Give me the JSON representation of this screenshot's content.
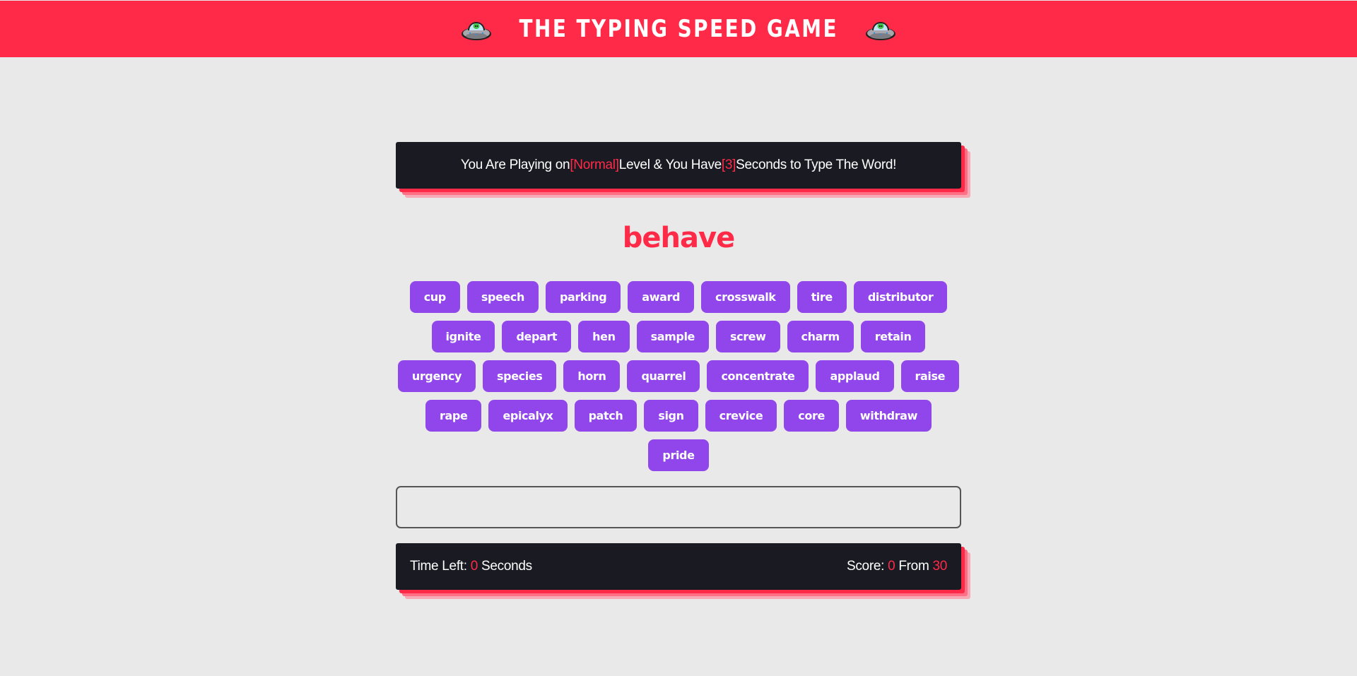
{
  "header": {
    "title": "The Typing Speed Game",
    "left_icon": "ufo-alien-icon",
    "right_icon": "ufo-alien-icon"
  },
  "message": {
    "prefix": "You Are Playing on ",
    "level": "[Normal]",
    "middle": " Level & You Have ",
    "seconds": "[3]",
    "suffix": " Seconds to Type The Word!"
  },
  "current_word": "behave",
  "upcoming_words": [
    "cup",
    "speech",
    "parking",
    "award",
    "crosswalk",
    "tire",
    "distributor",
    "ignite",
    "depart",
    "hen",
    "sample",
    "screw",
    "charm",
    "retain",
    "urgency",
    "species",
    "horn",
    "quarrel",
    "concentrate",
    "applaud",
    "raise",
    "rape",
    "epicalyx",
    "patch",
    "sign",
    "crevice",
    "core",
    "withdraw",
    "pride"
  ],
  "input": {
    "value": "",
    "placeholder": ""
  },
  "control": {
    "time_label": "Time Left: ",
    "time_value": "0",
    "time_unit": " Seconds",
    "score_label": "Score: ",
    "score_value": "0",
    "score_from": " From ",
    "score_total": "30"
  },
  "colors": {
    "accent": "#ff2a48",
    "panel": "#1a1a22",
    "chip": "#9146eb",
    "background": "#e9e9e9"
  }
}
